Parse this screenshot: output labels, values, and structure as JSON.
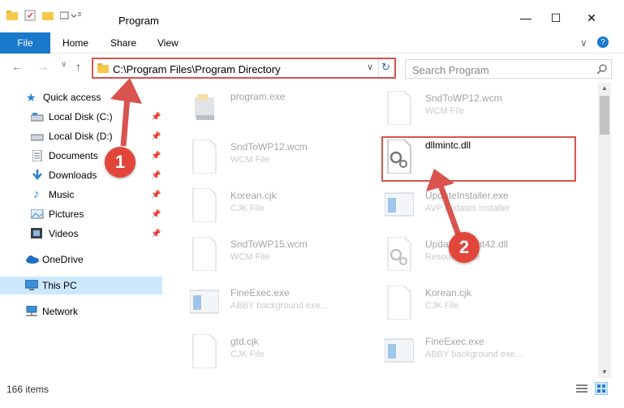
{
  "window": {
    "title": "Program",
    "minimize_icon": "minimize-icon",
    "maximize_icon": "maximize-icon",
    "close_icon": "close-icon"
  },
  "ribbon": {
    "tabs": [
      "File",
      "Home",
      "Share",
      "View"
    ],
    "accent": "#1979ca"
  },
  "address": {
    "path": "C:\\Program Files\\Program Directory",
    "search_placeholder": "Search Program"
  },
  "sidebar": {
    "items": [
      {
        "label": "Quick access",
        "icon": "star-icon"
      },
      {
        "label": "Local Disk (C:)",
        "icon": "drive-icon"
      },
      {
        "label": "Local Disk (D:)",
        "icon": "drive-icon"
      },
      {
        "label": "Documents",
        "icon": "documents-icon"
      },
      {
        "label": "Downloads",
        "icon": "download-icon"
      },
      {
        "label": "Music",
        "icon": "music-icon"
      },
      {
        "label": "Pictures",
        "icon": "pictures-icon"
      },
      {
        "label": "Videos",
        "icon": "videos-icon"
      },
      {
        "label": "OneDrive",
        "icon": "cloud-icon"
      },
      {
        "label": "This PC",
        "icon": "pc-icon"
      },
      {
        "label": "Network",
        "icon": "network-icon"
      }
    ]
  },
  "files": [
    {
      "name": "program.exe",
      "type": ""
    },
    {
      "name": "SndToWP12.wcm",
      "type": "WCM File"
    },
    {
      "name": "SndToWP12.wcm",
      "type": "WCM File"
    },
    {
      "name": "dllmintc.dll",
      "type": ""
    },
    {
      "name": "Korean.cjk",
      "type": "CJK File"
    },
    {
      "name": "UpdateInstaller.exe",
      "type": "AVP updates installer"
    },
    {
      "name": "SndToWP15.wcm",
      "type": "WCM File"
    },
    {
      "name": "UpdaterClient42.dll",
      "type": "Resource File"
    },
    {
      "name": "FineExec.exe",
      "type": "ABBY background exe..."
    },
    {
      "name": "Korean.cjk",
      "type": "CJK File"
    },
    {
      "name": "gtd.cjk",
      "type": "CJK File"
    },
    {
      "name": "FineExec.exe",
      "type": "ABBY background exe..."
    }
  ],
  "status": {
    "item_count": "166 items"
  },
  "annotations": {
    "step1": "1",
    "step2": "2",
    "color": "#d9534f"
  }
}
